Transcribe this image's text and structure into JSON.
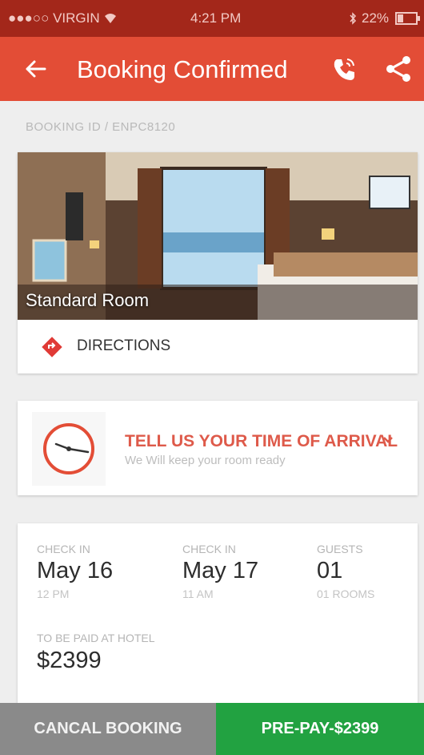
{
  "status": {
    "carrier": "●●●○○ VIRGIN",
    "time": "4:21 PM",
    "battery": "22%"
  },
  "appbar": {
    "title": "Booking Confirmed",
    "back_icon": "arrow-left-icon",
    "call_icon": "phone-icon",
    "share_icon": "share-icon"
  },
  "booking": {
    "id_label": "BOOKING ID / ENPC8120"
  },
  "room": {
    "label": "Standard Room",
    "directions": "DIRECTIONS"
  },
  "arrival": {
    "title": "TELL US YOUR TIME OF ARRIVAL",
    "subtitle": "We Will keep your room ready"
  },
  "details": {
    "checkin_label": "CHECK IN",
    "checkin_date": "May 16",
    "checkin_time": "12 PM",
    "checkout_label": "CHECK IN",
    "checkout_date": "May 17",
    "checkout_time": "11 AM",
    "guests_label": "GUESTS",
    "guests_value": "01",
    "rooms_value": "01 ROOMS",
    "paid_label": "TO BE PAID AT HOTEL",
    "paid_value": "$2399"
  },
  "actions": {
    "cancel": "CANCAL BOOKING",
    "prepay": "PRE-PAY-$2399"
  },
  "colors": {
    "status_bar": "#a3271a",
    "app_bar": "#e34d36",
    "accent": "#de5a4a",
    "cancel": "#8a8a8a",
    "prepay": "#22a241"
  }
}
